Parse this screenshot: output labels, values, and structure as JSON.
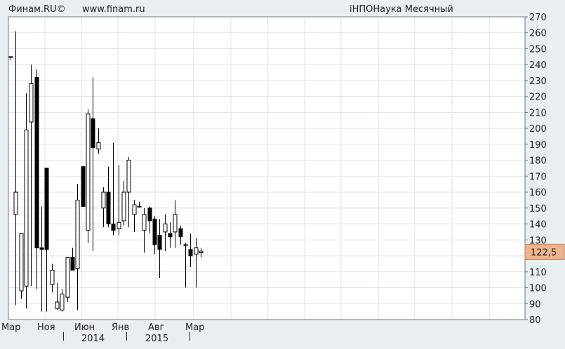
{
  "header": {
    "brand": "Финам.RU©",
    "site": "www.finam.ru",
    "title": "iНПОНаука Месячный"
  },
  "chart_data": {
    "type": "candlestick",
    "title": "iНПОНаука Месячный",
    "ylim": [
      80,
      270
    ],
    "yticks": [
      80,
      90,
      100,
      110,
      120,
      130,
      140,
      150,
      160,
      170,
      180,
      190,
      200,
      210,
      220,
      230,
      240,
      250,
      260,
      270
    ],
    "grid": true,
    "last_price": {
      "label": "122,5",
      "value": 122.5,
      "color": "#f0b48c"
    },
    "x_month_labels": [
      "Мар",
      "Ноя",
      "Июн",
      "Янв",
      "Авг",
      "Мар"
    ],
    "x_year_labels": [
      "2014",
      "2015"
    ],
    "colors": {
      "up": "#ffffff",
      "down": "#000000",
      "outline": "#000000",
      "grid": "#dde3ea",
      "plot_bg": "#ffffff"
    },
    "candles": [
      {
        "o": 245,
        "h": 245,
        "l": 243,
        "c": 245
      },
      {
        "o": 146,
        "h": 261,
        "l": 89,
        "c": 160
      },
      {
        "o": 98,
        "h": 134,
        "l": 93,
        "c": 134
      },
      {
        "o": 101,
        "h": 222,
        "l": 87,
        "c": 199
      },
      {
        "o": 204,
        "h": 240,
        "l": 101,
        "c": 228
      },
      {
        "o": 232,
        "h": 237,
        "l": 99,
        "c": 125
      },
      {
        "o": 125,
        "h": 151,
        "l": 85,
        "c": 124
      },
      {
        "o": 175,
        "h": 175,
        "l": 85,
        "c": 124
      },
      {
        "o": 102,
        "h": 115,
        "l": 97,
        "c": 111
      },
      {
        "o": 87,
        "h": 103,
        "l": 86,
        "c": 91
      },
      {
        "o": 86,
        "h": 99,
        "l": 85,
        "c": 96
      },
      {
        "o": 94,
        "h": 112,
        "l": 91,
        "c": 119
      },
      {
        "o": 119,
        "h": 125,
        "l": 112,
        "c": 111
      },
      {
        "o": 112,
        "h": 165,
        "l": 86,
        "c": 155
      },
      {
        "o": 176,
        "h": 176,
        "l": 151,
        "c": 151
      },
      {
        "o": 136,
        "h": 212,
        "l": 128,
        "c": 209
      },
      {
        "o": 206,
        "h": 232,
        "l": 123,
        "c": 188
      },
      {
        "o": 187,
        "h": 200,
        "l": 184,
        "c": 191
      },
      {
        "o": 150,
        "h": 163,
        "l": 138,
        "c": 160
      },
      {
        "o": 160,
        "h": 176,
        "l": 138,
        "c": 140
      },
      {
        "o": 140,
        "h": 191,
        "l": 133,
        "c": 136
      },
      {
        "o": 137,
        "h": 177,
        "l": 133,
        "c": 141
      },
      {
        "o": 142,
        "h": 167,
        "l": 139,
        "c": 160
      },
      {
        "o": 160,
        "h": 182,
        "l": 138,
        "c": 180
      },
      {
        "o": 146,
        "h": 155,
        "l": 135,
        "c": 152
      },
      {
        "o": 151,
        "h": 154,
        "l": 151,
        "c": 151
      },
      {
        "o": 136,
        "h": 150,
        "l": 122,
        "c": 146
      },
      {
        "o": 150,
        "h": 151,
        "l": 134,
        "c": 142
      },
      {
        "o": 143,
        "h": 145,
        "l": 121,
        "c": 127
      },
      {
        "o": 133,
        "h": 143,
        "l": 106,
        "c": 124
      },
      {
        "o": 135,
        "h": 146,
        "l": 123,
        "c": 140
      },
      {
        "o": 134,
        "h": 141,
        "l": 125,
        "c": 132
      },
      {
        "o": 135,
        "h": 155,
        "l": 125,
        "c": 146
      },
      {
        "o": 137,
        "h": 139,
        "l": 127,
        "c": 132
      },
      {
        "o": 127,
        "h": 128,
        "l": 100,
        "c": 127
      },
      {
        "o": 124,
        "h": 134,
        "l": 113,
        "c": 120
      },
      {
        "o": 121,
        "h": 131,
        "l": 100,
        "c": 125
      },
      {
        "o": 122,
        "h": 125,
        "l": 119,
        "c": 123
      }
    ]
  }
}
